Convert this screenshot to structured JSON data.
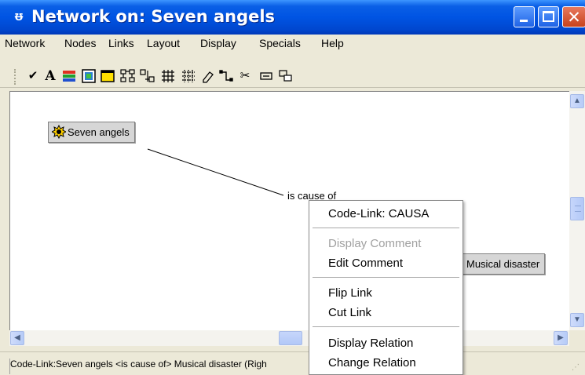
{
  "window": {
    "title": "Network on: Seven angels"
  },
  "menubar": {
    "items": [
      "Network",
      "Nodes",
      "Links",
      "Layout",
      "Display",
      "Specials",
      "Help"
    ]
  },
  "toolbar": {
    "icons": [
      "check-icon",
      "font-icon",
      "color-bars-icon",
      "node-color-icon",
      "rectangle-icon",
      "layout-tree-icon",
      "layout-arrange-icon",
      "network-grid-icon",
      "network-dotted-icon",
      "eraser-icon",
      "connector-icon",
      "cut-icon",
      "comment-icon",
      "copy-nodes-icon"
    ],
    "glyphs": [
      "✔",
      "A",
      "≡",
      "▣",
      "▭",
      "⌗",
      "⇳",
      "#",
      "⌧",
      "⌀",
      "⌐",
      "✂",
      "▭",
      "⧉"
    ]
  },
  "canvas": {
    "node_source": "Seven angels",
    "node_target": "Musical disaster",
    "link_label": "is cause of"
  },
  "context_menu": {
    "items": [
      {
        "label": "Code-Link: CAUSA",
        "disabled": false
      },
      {
        "label": "Display Comment",
        "disabled": true
      },
      {
        "label": "Edit Comment",
        "disabled": false
      },
      {
        "label": "Flip Link",
        "disabled": false
      },
      {
        "label": "Cut Link",
        "disabled": false
      },
      {
        "label": "Display Relation",
        "disabled": false
      },
      {
        "label": "Change Relation",
        "disabled": false
      }
    ]
  },
  "statusbar": {
    "text": "Code-Link:Seven angels <is cause of> Musical disaster (Righ"
  },
  "colors": {
    "titlebar": "#0054e3",
    "node_fill": "#d6d6d6",
    "disabled_text": "#a0a0a0"
  }
}
